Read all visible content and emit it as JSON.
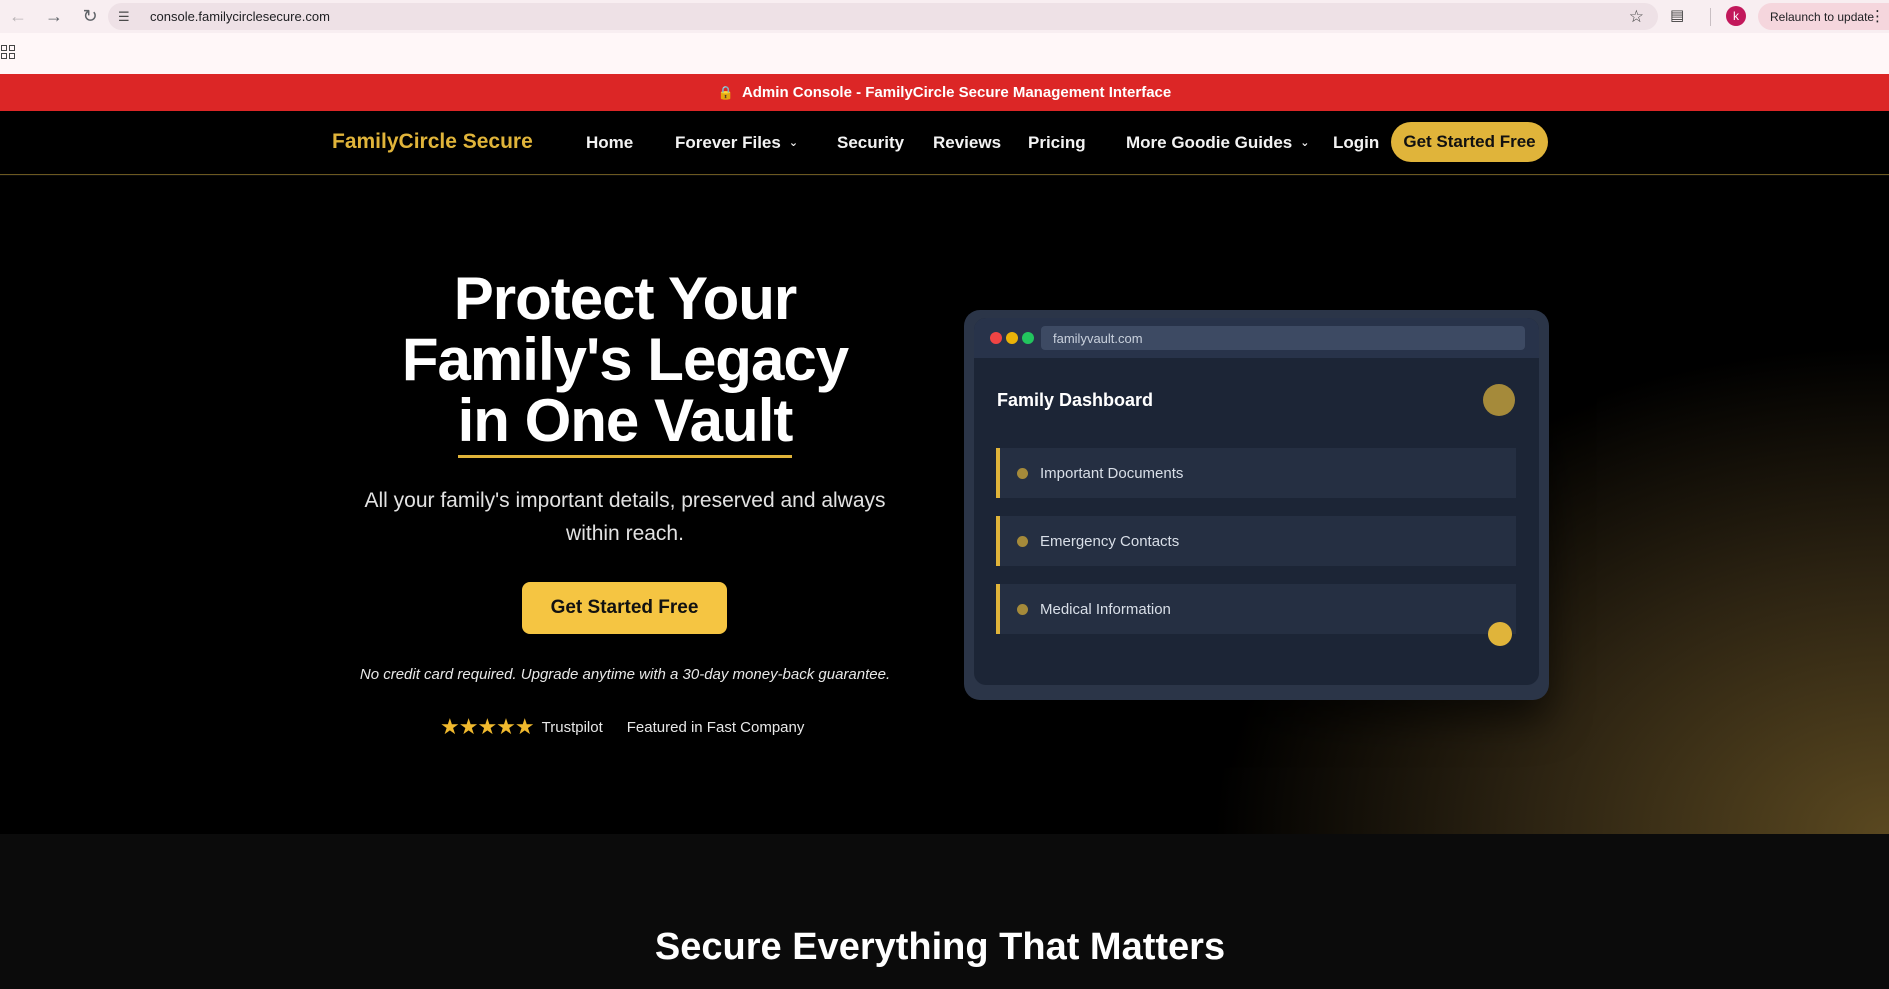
{
  "browser": {
    "url": "console.familycirclesecure.com",
    "profile_initial": "k",
    "relaunch_label": "Relaunch to update"
  },
  "banner": {
    "text": "Admin Console - FamilyCircle Secure Management Interface",
    "color": "#dc2626"
  },
  "nav": {
    "brand": "FamilyCircle Secure",
    "links": [
      "Home",
      "Forever Files",
      "Security",
      "Reviews",
      "Pricing",
      "More Goodie Guides",
      "Login"
    ],
    "cta": "Get Started Free",
    "accent": "#e0b43a"
  },
  "hero": {
    "title_line1": "Protect Your",
    "title_line2": "Family's Legacy",
    "title_line3": "in One Vault",
    "subtitle": "All your family's important details, preserved and always within reach.",
    "cta": "Get Started Free",
    "note": "No credit card required. Upgrade anytime with a 30-day money-back guarantee.",
    "rating_stars": 5,
    "trust_label": "Trustpilot",
    "featured": "Featured in Fast Company"
  },
  "mockup": {
    "url": "familyvault.com",
    "title": "Family Dashboard",
    "items": [
      "Important Documents",
      "Emergency Contacts",
      "Medical Information"
    ]
  },
  "section": {
    "title": "Secure Everything That Matters"
  }
}
